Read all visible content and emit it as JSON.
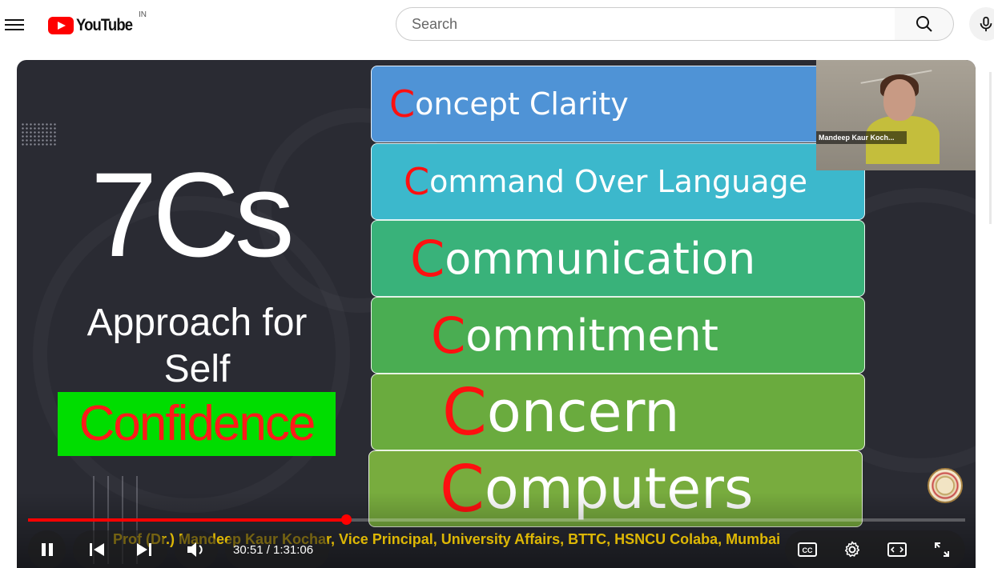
{
  "header": {
    "logo_text": "YouTube",
    "country_code": "IN",
    "search_placeholder": "Search"
  },
  "slide": {
    "heading": "7Cs",
    "subtitle_line1": "Approach for",
    "subtitle_line2": "Self",
    "highlight": "Confidence",
    "items": [
      {
        "first": "C",
        "rest": "oncept Clarity",
        "color": "#4f93d6"
      },
      {
        "first": "C",
        "rest": "ommand Over Language",
        "color": "#3cb8cc"
      },
      {
        "first": "C",
        "rest": "ommunication",
        "color": "#39b27a"
      },
      {
        "first": "C",
        "rest": "ommitment",
        "color": "#4aad52"
      },
      {
        "first": "C",
        "rest": "oncern",
        "color": "#6aab3e"
      },
      {
        "first": "C",
        "rest": "omputers",
        "color": "#78ac3e"
      }
    ],
    "footer_text": "Prof (Dr.) Mandeep Kaur Kochar, Vice Principal, University Affairs, BTTC, HSNCU Colaba, Mumbai"
  },
  "webcam": {
    "name_label": "Mandeep Kaur Koch..."
  },
  "player": {
    "current_time": "30:51",
    "duration": "1:31:06",
    "time_display": "30:51 / 1:31:06",
    "progress": 0.339,
    "accent_color": "#ff0000",
    "left_controls": [
      "pause-icon",
      "previous-icon",
      "next-icon",
      "volume-icon"
    ],
    "right_controls": [
      "subtitles-icon",
      "settings-icon",
      "theater-mode-icon",
      "fullscreen-icon"
    ]
  }
}
